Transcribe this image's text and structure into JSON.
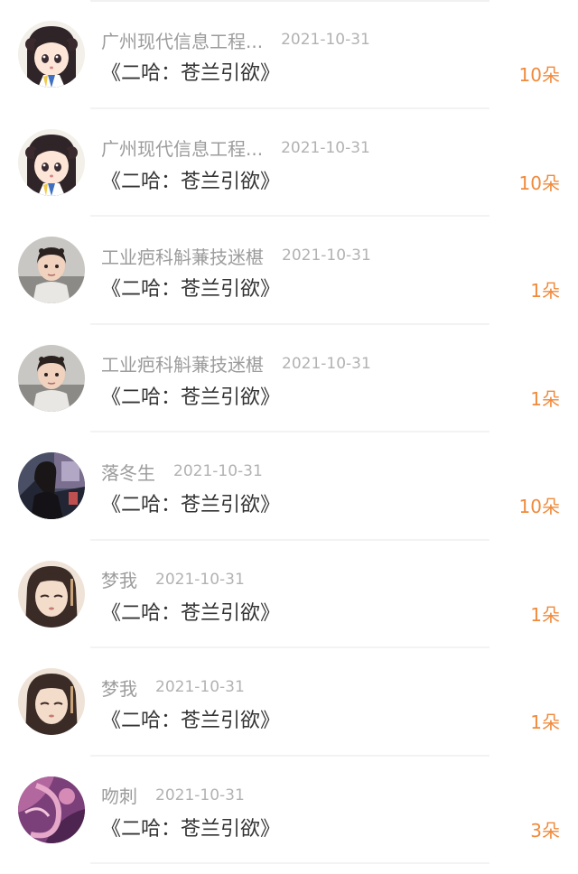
{
  "items": [
    {
      "name": "广州现代信息工程...",
      "date": "2021-10-31",
      "title": "《二哈：苍兰引欲》",
      "amount": "10朵",
      "avatar": "anime-girl-avatar-icon"
    },
    {
      "name": "广州现代信息工程...",
      "date": "2021-10-31",
      "title": "《二哈：苍兰引欲》",
      "amount": "10朵",
      "avatar": "anime-girl-avatar-icon"
    },
    {
      "name": "工业疤科斛蒹技迷椹",
      "date": "2021-10-31",
      "title": "《二哈：苍兰引欲》",
      "amount": "1朵",
      "avatar": "child-photo-avatar-icon"
    },
    {
      "name": "工业疤科斛蒹技迷椹",
      "date": "2021-10-31",
      "title": "《二哈：苍兰引欲》",
      "amount": "1朵",
      "avatar": "child-photo-avatar-icon"
    },
    {
      "name": "落冬生",
      "date": "2021-10-31",
      "title": "《二哈：苍兰引欲》",
      "amount": "10朵",
      "avatar": "dark-photo-avatar-icon"
    },
    {
      "name": "梦我",
      "date": "2021-10-31",
      "title": "《二哈：苍兰引欲》",
      "amount": "1朵",
      "avatar": "illustrated-woman-avatar-icon"
    },
    {
      "name": "梦我",
      "date": "2021-10-31",
      "title": "《二哈：苍兰引欲》",
      "amount": "1朵",
      "avatar": "illustrated-woman-avatar-icon"
    },
    {
      "name": "吻刺",
      "date": "2021-10-31",
      "title": "《二哈：苍兰引欲》",
      "amount": "3朵",
      "avatar": "abstract-purple-avatar-icon"
    }
  ],
  "colors": {
    "name_text": "#9c9c9c",
    "date_text": "#b2b2b2",
    "title_text": "#333333",
    "amount_accent": "#f08a3c",
    "divider": "#f3f3f3"
  }
}
